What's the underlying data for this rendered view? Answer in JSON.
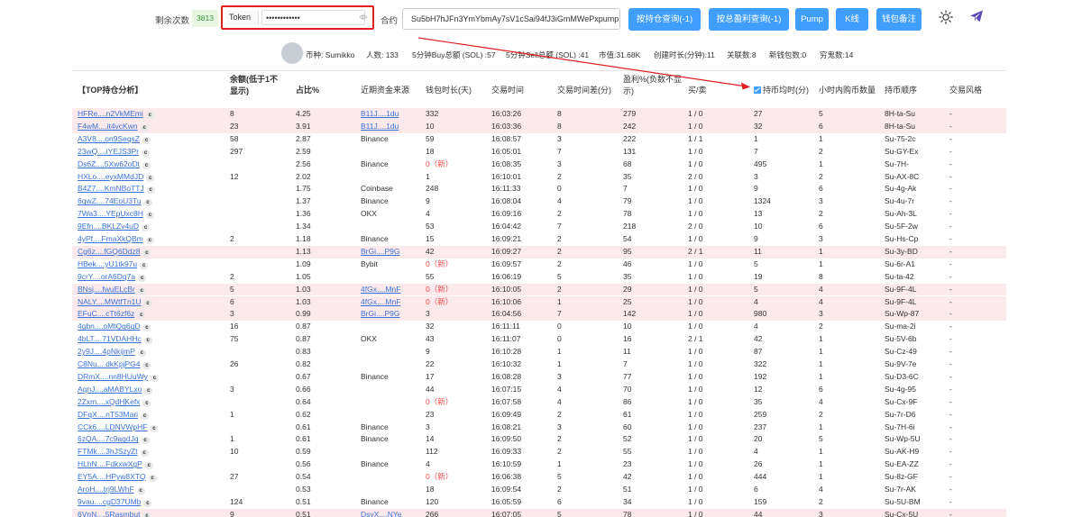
{
  "header": {
    "remain_label": "剩余次数",
    "remain_count": "3813",
    "token_label": "Token",
    "token_value": "••••••••••••",
    "contract_label": "合约",
    "contract_value": "Su5bH7hJFn3YmYbmAy7sV1cSai94fJ3iGmMWePxpump",
    "buttons": [
      "按持仓查询(-1)",
      "按总盈利查询(-1)",
      "Pump",
      "K线",
      "钱包备注"
    ],
    "accent_color": "#409eff",
    "highlight_color": "#e02020"
  },
  "info": {
    "coin": "币种: Sumikko",
    "people": "人数: 133",
    "buy5": "5分钟Buy总额 (SOL) :57",
    "sell5": "5分钟Sell总额 (SOL) :41",
    "mcap": "市值:31.68K",
    "created": "创建时长(分钟):11",
    "related": "关联数:8",
    "new_wallets": "新钱包数:0",
    "poor": "穷鬼数:14"
  },
  "table": {
    "headers": [
      "【TOP持仓分析】",
      "余额(低于1不显示)",
      "占比%",
      "近期资金来源",
      "钱包时长(天)",
      "交易时间",
      "交易时间差(分)",
      "盈利%(负数不显示)",
      "买/卖",
      "持币均时(分)",
      "小时内购币数量",
      "持币顺序",
      "交易风格"
    ],
    "rows": [
      {
        "a": "HFRe....n2VkMEmi",
        "b": "8",
        "p": "4.25",
        "s": "B11J....1du",
        "sl": true,
        "d": "332",
        "t": "16:03:26",
        "td": "8",
        "pr": "279",
        "bs": "1 / 0",
        "h": "27",
        "q": "5",
        "o": "8H-ta-Su",
        "st": "-",
        "hl": true
      },
      {
        "a": "F4wM....it4vcKwn",
        "b": "23",
        "p": "3.91",
        "s": "B11J....1du",
        "sl": true,
        "d": "10",
        "t": "16:03:36",
        "td": "8",
        "pr": "242",
        "bs": "1 / 0",
        "h": "32",
        "q": "6",
        "o": "8H-ta-Su",
        "st": "-",
        "hl": true
      },
      {
        "a": "A3V8....on9SeqsZ",
        "b": "58",
        "p": "2.87",
        "s": "Binance",
        "sl": false,
        "d": "59",
        "t": "16:08:57",
        "td": "3",
        "pr": "222",
        "bs": "1 / 1",
        "h": "1",
        "q": "1",
        "o": "Su-75-2c",
        "st": "-",
        "hl": false
      },
      {
        "a": "23wQ....iYEJS3Pr",
        "b": "297",
        "p": "2.59",
        "s": "",
        "sl": false,
        "d": "18",
        "t": "16:05:01",
        "td": "7",
        "pr": "131",
        "bs": "1 / 0",
        "h": "7",
        "q": "2",
        "o": "Su-GY-Ex",
        "st": "-",
        "hl": false
      },
      {
        "a": "Ds6Z....5Xw62oDt",
        "b": "",
        "p": "2.56",
        "s": "Binance",
        "sl": false,
        "d": "0（新）",
        "dr": true,
        "t": "16:08:35",
        "td": "3",
        "pr": "68",
        "bs": "1 / 0",
        "h": "495",
        "q": "1",
        "o": "Su-7H-",
        "st": "-",
        "hl": false
      },
      {
        "a": "HXLo....eyxMMdJD",
        "b": "12",
        "p": "2.02",
        "s": "",
        "sl": false,
        "d": "1",
        "t": "16:10:01",
        "td": "2",
        "pr": "35",
        "bs": "2 / 0",
        "h": "3",
        "q": "2",
        "o": "Su-AX-8C",
        "st": "-",
        "hl": false
      },
      {
        "a": "B4Z7....KmNBoTTJ",
        "b": "",
        "p": "1.75",
        "s": "Coinbase",
        "sl": false,
        "d": "248",
        "t": "16:11:33",
        "td": "0",
        "pr": "7",
        "bs": "1 / 0",
        "h": "9",
        "q": "6",
        "o": "Su-4g-Ak",
        "st": "-",
        "hl": false
      },
      {
        "a": "6qwZ....74EoU3Tu",
        "b": "",
        "p": "1.37",
        "s": "Binance",
        "sl": false,
        "d": "9",
        "t": "16:08:04",
        "td": "4",
        "pr": "79",
        "bs": "1 / 0",
        "h": "1324",
        "q": "3",
        "o": "Su-4u-7r",
        "st": "-",
        "hl": false
      },
      {
        "a": "7Wa3....YEpUxc8H",
        "b": "",
        "p": "1.36",
        "s": "OKX",
        "sl": false,
        "d": "4",
        "t": "16:09:16",
        "td": "2",
        "pr": "78",
        "bs": "1 / 0",
        "h": "13",
        "q": "2",
        "o": "Su-Ah-3L",
        "st": "-",
        "hl": false
      },
      {
        "a": "9Efn....BKLZv4uD",
        "b": "",
        "p": "1.34",
        "s": "",
        "sl": false,
        "d": "53",
        "t": "16:04:42",
        "td": "7",
        "pr": "218",
        "bs": "2 / 0",
        "h": "10",
        "q": "6",
        "o": "Su-5F-2w",
        "st": "-",
        "hl": false
      },
      {
        "a": "4yPf....FmaXkQBm",
        "b": "2",
        "p": "1.18",
        "s": "Binance",
        "sl": false,
        "d": "15",
        "t": "16:09:21",
        "td": "2",
        "pr": "54",
        "bs": "1 / 0",
        "h": "9",
        "q": "3",
        "o": "Su-Hs-Cp",
        "st": "-",
        "hl": false
      },
      {
        "a": "Cg6z....fGQ6Ddz8",
        "b": "",
        "p": "1.13",
        "s": "BrGi....P9G",
        "sl": true,
        "d": "42",
        "t": "16:09:27",
        "td": "2",
        "pr": "95",
        "bs": "2 / 1",
        "h": "11",
        "q": "1",
        "o": "Su-3y-BD",
        "st": "-",
        "hl": true
      },
      {
        "a": "HBek....yU1tk97u",
        "b": "",
        "p": "1.09",
        "s": "Bybit",
        "sl": false,
        "d": "0（新）",
        "dr": true,
        "t": "16:09:57",
        "td": "2",
        "pr": "46",
        "bs": "1 / 0",
        "h": "5",
        "q": "1",
        "o": "Su-6r-A1",
        "st": "-",
        "hl": false
      },
      {
        "a": "9crY....orA6Dq7a",
        "b": "2",
        "p": "1.05",
        "s": "",
        "sl": false,
        "d": "55",
        "t": "16:06:19",
        "td": "5",
        "pr": "35",
        "bs": "1 / 0",
        "h": "19",
        "q": "8",
        "o": "Su-ta-42",
        "st": "-",
        "hl": false
      },
      {
        "a": "BNsj....fwuELcBr",
        "b": "5",
        "p": "1.03",
        "s": "4fGx....MnF",
        "sl": true,
        "d": "0（新）",
        "dr": true,
        "t": "16:10:05",
        "td": "2",
        "pr": "29",
        "bs": "1 / 0",
        "h": "5",
        "q": "4",
        "o": "Su-9F-4L",
        "st": "-",
        "hl": true
      },
      {
        "a": "NALY....MWtfTn1U",
        "b": "6",
        "p": "1.03",
        "s": "4fGx....MnF",
        "sl": true,
        "d": "0（新）",
        "dr": true,
        "t": "16:10:06",
        "td": "1",
        "pr": "25",
        "bs": "1 / 0",
        "h": "4",
        "q": "4",
        "o": "Su-9F-4L",
        "st": "-",
        "hl": true
      },
      {
        "a": "EFuC....cTt6zf6z",
        "b": "3",
        "p": "0.99",
        "s": "BrGi....P9G",
        "sl": true,
        "d": "3",
        "t": "16:04:56",
        "td": "7",
        "pr": "142",
        "bs": "1 / 0",
        "h": "980",
        "q": "3",
        "o": "Su-Wp-87",
        "st": "-",
        "hl": true
      },
      {
        "a": "4gbn....oMtQq6qD",
        "b": "16",
        "p": "0.87",
        "s": "",
        "sl": false,
        "d": "32",
        "t": "16:11:11",
        "td": "0",
        "pr": "10",
        "bs": "1 / 0",
        "h": "4",
        "q": "2",
        "o": "Su-ma-2i",
        "st": "-",
        "hl": false
      },
      {
        "a": "4bLT....71VDAHHc",
        "b": "75",
        "p": "0.87",
        "s": "OKX",
        "sl": false,
        "d": "43",
        "t": "16:11:07",
        "td": "0",
        "pr": "16",
        "bs": "2 / 1",
        "h": "42",
        "q": "1",
        "o": "Su-5V-6b",
        "st": "-",
        "hl": false
      },
      {
        "a": "2y9J....4pNkijmP",
        "b": "",
        "p": "0.83",
        "s": "",
        "sl": false,
        "d": "9",
        "t": "16:10:28",
        "td": "1",
        "pr": "11",
        "bs": "1 / 0",
        "h": "87",
        "q": "1",
        "o": "Su-Cz-49",
        "st": "-",
        "hl": false
      },
      {
        "a": "C8Nu....dkKpjPG4",
        "b": "26",
        "p": "0.82",
        "s": "",
        "sl": false,
        "d": "22",
        "t": "16:10:32",
        "td": "1",
        "pr": "7",
        "bs": "1 / 0",
        "h": "322",
        "q": "1",
        "o": "Su-9V-7e",
        "st": "-",
        "hl": false
      },
      {
        "a": "DRmX....nn8HUuWy",
        "b": "",
        "p": "0.67",
        "s": "Binance",
        "sl": false,
        "d": "17",
        "t": "16:08:28",
        "td": "3",
        "pr": "77",
        "bs": "1 / 0",
        "h": "192",
        "q": "1",
        "o": "Su-D3-6C",
        "st": "-",
        "hl": false
      },
      {
        "a": "AqnJ....aMABYLxo",
        "b": "3",
        "p": "0.66",
        "s": "",
        "sl": false,
        "d": "44",
        "t": "16:07:15",
        "td": "4",
        "pr": "70",
        "bs": "1 / 0",
        "h": "12",
        "q": "6",
        "o": "Su-4g-95",
        "st": "-",
        "hl": false
      },
      {
        "a": "2Zxm....xQdHKefx",
        "b": "",
        "p": "0.64",
        "s": "",
        "sl": false,
        "d": "0（新）",
        "dr": true,
        "t": "16:07:58",
        "td": "4",
        "pr": "86",
        "bs": "1 / 0",
        "h": "35",
        "q": "4",
        "o": "Su-Cx-9F",
        "st": "-",
        "hl": false
      },
      {
        "a": "DFqX....nT53Mari",
        "b": "1",
        "p": "0.62",
        "s": "",
        "sl": false,
        "d": "23",
        "t": "16:09:49",
        "td": "2",
        "pr": "61",
        "bs": "1 / 0",
        "h": "259",
        "q": "2",
        "o": "Su-7r-D6",
        "st": "-",
        "hl": false
      },
      {
        "a": "CCk6....LDNVWpHF",
        "b": "",
        "p": "0.61",
        "s": "Binance",
        "sl": false,
        "d": "3",
        "t": "16:08:21",
        "td": "3",
        "pr": "60",
        "bs": "1 / 0",
        "h": "237",
        "q": "1",
        "o": "Su-7H-6i",
        "st": "-",
        "hl": false
      },
      {
        "a": "6zQA....7c9agdJq",
        "b": "1",
        "p": "0.61",
        "s": "Binance",
        "sl": false,
        "d": "14",
        "t": "16:09:50",
        "td": "2",
        "pr": "52",
        "bs": "1 / 0",
        "h": "20",
        "q": "5",
        "o": "Su-Wp-5U",
        "st": "-",
        "hl": false
      },
      {
        "a": "FTMk....3hJSzyZt",
        "b": "10",
        "p": "0.59",
        "s": "",
        "sl": false,
        "d": "112",
        "t": "16:09:33",
        "td": "2",
        "pr": "55",
        "bs": "1 / 0",
        "h": "4",
        "q": "1",
        "o": "Su-AK-H9",
        "st": "-",
        "hl": false
      },
      {
        "a": "HLhN....FdkxwXgP",
        "b": "",
        "p": "0.56",
        "s": "Binance",
        "sl": false,
        "d": "4",
        "t": "16:10:59",
        "td": "1",
        "pr": "23",
        "bs": "1 / 0",
        "h": "26",
        "q": "1",
        "o": "Su-EA-ZZ",
        "st": "-",
        "hl": false
      },
      {
        "a": "EY5A....HPyw8XTQ",
        "b": "27",
        "p": "0.54",
        "s": "",
        "sl": false,
        "d": "0（新）",
        "dr": true,
        "t": "16:06:38",
        "td": "5",
        "pr": "42",
        "bs": "1 / 0",
        "h": "444",
        "q": "1",
        "o": "Su-8z-GF",
        "st": "-",
        "hl": false
      },
      {
        "a": "AroH....trj9LWhF",
        "b": "",
        "p": "0.53",
        "s": "",
        "sl": false,
        "d": "18",
        "t": "16:09:54",
        "td": "2",
        "pr": "51",
        "bs": "1 / 0",
        "h": "6",
        "q": "4",
        "o": "Su-7r-AK",
        "st": "-",
        "hl": false
      },
      {
        "a": "9vau....cgD37UMb",
        "b": "124",
        "p": "0.51",
        "s": "Binance",
        "sl": false,
        "d": "120",
        "t": "16:05:59",
        "td": "6",
        "pr": "34",
        "bs": "1 / 0",
        "h": "159",
        "q": "2",
        "o": "Su-5U-BM",
        "st": "-",
        "hl": false
      },
      {
        "a": "6VnN....5Rasmbut",
        "b": "9",
        "p": "0.51",
        "s": "DsyX....NYe",
        "sl": true,
        "d": "266",
        "t": "16:07:05",
        "td": "5",
        "pr": "78",
        "bs": "1 / 0",
        "h": "44",
        "q": "3",
        "o": "Su-Cx-5U",
        "st": "-",
        "hl": true
      }
    ]
  }
}
